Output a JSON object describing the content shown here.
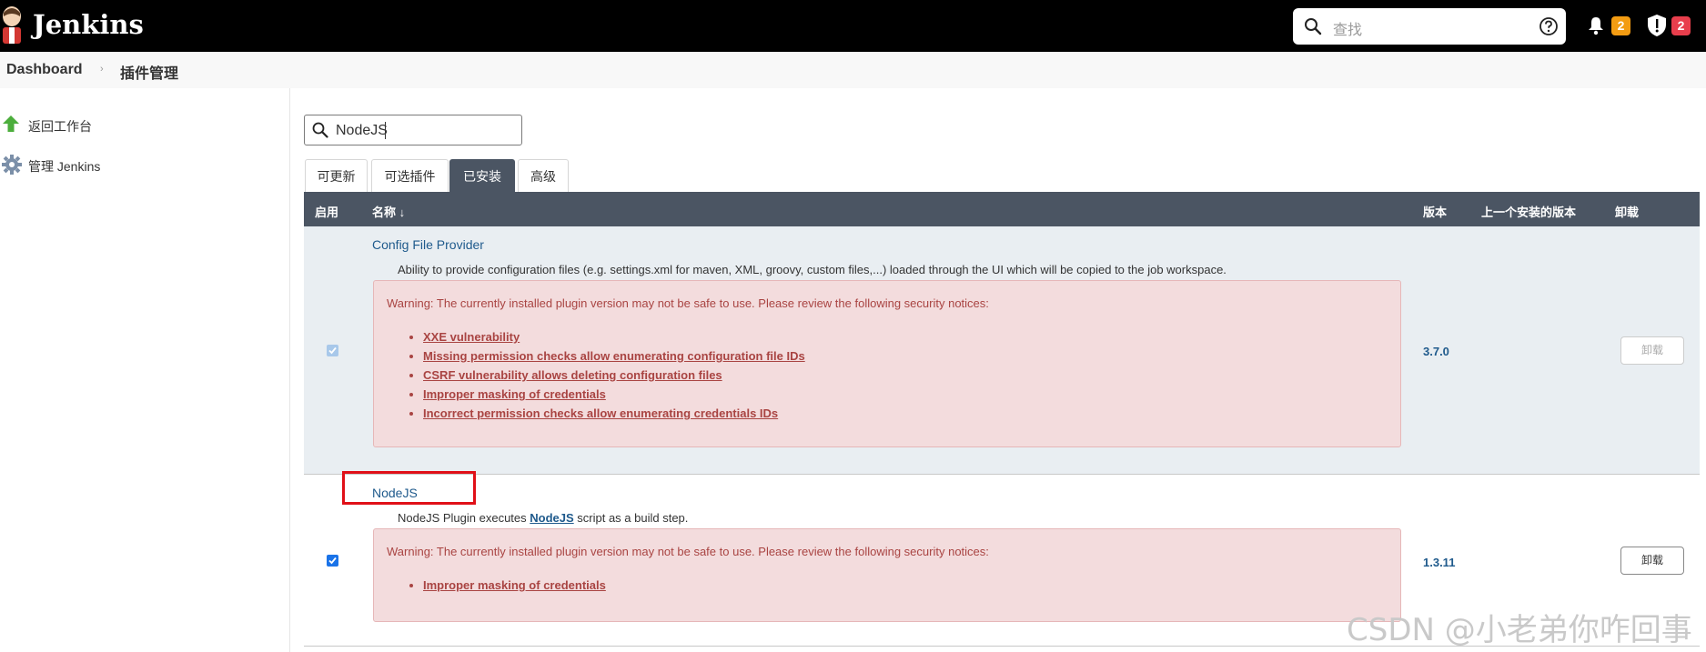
{
  "header": {
    "brand": "Jenkins",
    "search_placeholder": "查找",
    "notifications_count": "2",
    "security_count": "2",
    "colors": {
      "bar": "#000000",
      "notifications_badge": "#f39c12",
      "security_badge": "#e83e4c"
    }
  },
  "breadcrumb": {
    "items": [
      "Dashboard",
      "插件管理"
    ]
  },
  "sidebar": {
    "items": [
      {
        "label": "返回工作台",
        "icon": "up-arrow-icon"
      },
      {
        "label": "管理 Jenkins",
        "icon": "gear-icon"
      }
    ]
  },
  "filter": {
    "value": "NodeJS"
  },
  "tabs": [
    {
      "label": "可更新",
      "active": false
    },
    {
      "label": "可选插件",
      "active": false
    },
    {
      "label": "已安装",
      "active": true
    },
    {
      "label": "高级",
      "active": false
    }
  ],
  "table": {
    "headers": {
      "enabled": "启用",
      "name": "名称 ↓",
      "version": "版本",
      "previous": "上一个安装的版本",
      "uninstall": "卸载"
    },
    "rows": [
      {
        "name": "Config File Provider",
        "description": "Ability to provide configuration files (e.g. settings.xml for maven, XML, groovy, custom files,...) loaded through the UI which will be copied to the job workspace.",
        "warning": "Warning: The currently installed plugin version may not be safe to use. Please review the following security notices:",
        "notices": [
          "XXE vulnerability",
          "Missing permission checks allow enumerating configuration file IDs",
          "CSRF vulnerability allows deleting configuration files",
          "Improper masking of credentials",
          "Incorrect permission checks allow enumerating credentials IDs"
        ],
        "checked": true,
        "checkbox_disabled": true,
        "version": "3.7.0",
        "uninstall_label": "卸载",
        "uninstall_disabled": true
      },
      {
        "name": "NodeJS",
        "description_prefix": "NodeJS Plugin executes ",
        "description_link": "NodeJS",
        "description_suffix": " script as a build step.",
        "warning": "Warning: The currently installed plugin version may not be safe to use. Please review the following security notices:",
        "notices": [
          "Improper masking of credentials"
        ],
        "checked": true,
        "checkbox_disabled": false,
        "version": "1.3.11",
        "uninstall_label": "卸载",
        "uninstall_disabled": false
      }
    ]
  },
  "watermark": "CSDN @小老弟你咋回事"
}
